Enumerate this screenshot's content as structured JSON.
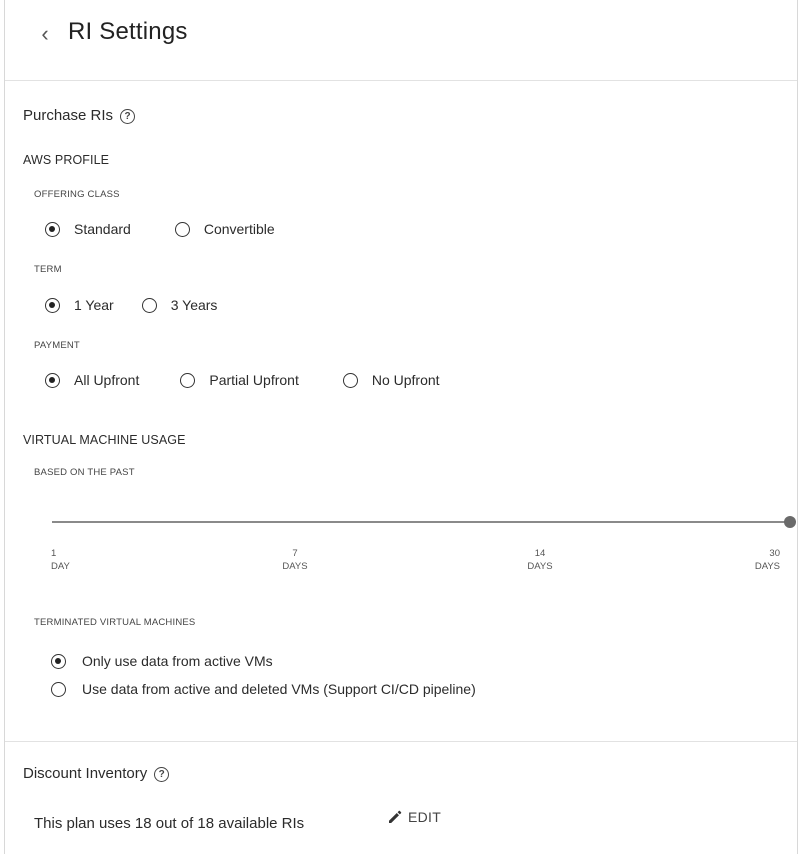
{
  "header": {
    "back_icon": "chevron-left-icon",
    "back_glyph": "‹",
    "title": "RI Settings"
  },
  "purchase": {
    "title": "Purchase RIs",
    "help_icon": "question-circle-icon",
    "help_glyph": "?",
    "aws_profile_label": "AWS PROFILE",
    "offering_class": {
      "label": "OFFERING CLASS",
      "options": [
        "Standard",
        "Convertible"
      ],
      "selected": "Standard"
    },
    "term": {
      "label": "TERM",
      "options": [
        "1 Year",
        "3 Years"
      ],
      "selected": "1 Year"
    },
    "payment": {
      "label": "PAYMENT",
      "options": [
        "All Upfront",
        "Partial Upfront",
        "No Upfront"
      ],
      "selected": "All Upfront"
    }
  },
  "vm_usage": {
    "title": "VIRTUAL MACHINE USAGE",
    "based_on_label": "BASED ON THE PAST",
    "slider": {
      "ticks": [
        {
          "value": "1",
          "unit": "DAY"
        },
        {
          "value": "7",
          "unit": "DAYS"
        },
        {
          "value": "14",
          "unit": "DAYS"
        },
        {
          "value": "30",
          "unit": "DAYS"
        }
      ],
      "selected_value": "30"
    },
    "terminated": {
      "label": "TERMINATED VIRTUAL MACHINES",
      "options": [
        "Only use data from active VMs",
        "Use data from active and deleted VMs (Support CI/CD pipeline)"
      ],
      "selected": "Only use data from active VMs"
    }
  },
  "inventory": {
    "title": "Discount Inventory",
    "help_glyph": "?",
    "text": "This plan uses 18 out of 18 available RIs",
    "edit_icon": "pencil-icon",
    "edit_label": "EDIT"
  },
  "colors": {
    "text": "#2b2b2b",
    "divider": "#e2e2e2",
    "slider": "#8a8a8a"
  }
}
